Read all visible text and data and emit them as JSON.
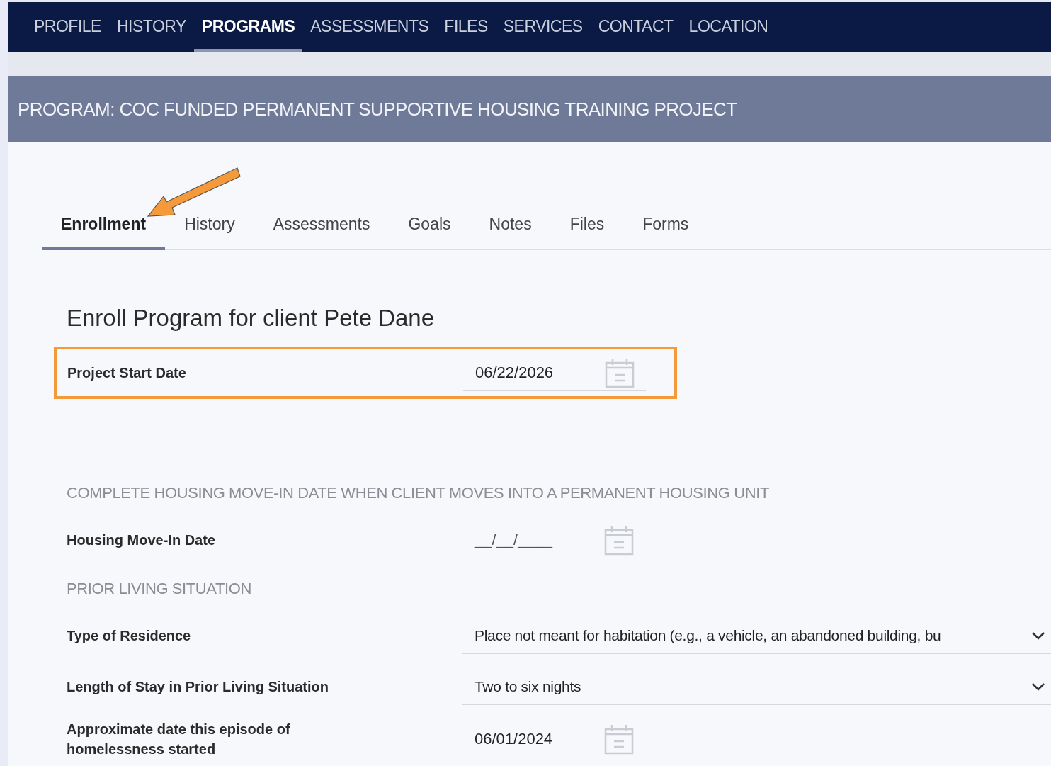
{
  "nav": [
    {
      "label": "PROFILE",
      "selected": false
    },
    {
      "label": "HISTORY",
      "selected": false
    },
    {
      "label": "PROGRAMS",
      "selected": true
    },
    {
      "label": "ASSESSMENTS",
      "selected": false
    },
    {
      "label": "FILES",
      "selected": false
    },
    {
      "label": "SERVICES",
      "selected": false
    },
    {
      "label": "CONTACT",
      "selected": false
    },
    {
      "label": "LOCATION",
      "selected": false
    }
  ],
  "program_title": "PROGRAM: COC FUNDED PERMANENT SUPPORTIVE HOUSING TRAINING PROJECT",
  "tabs": [
    {
      "label": "Enrollment",
      "selected": true
    },
    {
      "label": "History",
      "selected": false
    },
    {
      "label": "Assessments",
      "selected": false
    },
    {
      "label": "Goals",
      "selected": false
    },
    {
      "label": "Notes",
      "selected": false
    },
    {
      "label": "Files",
      "selected": false
    },
    {
      "label": "Forms",
      "selected": false
    }
  ],
  "form_title": "Enroll Program for client Pete Dane",
  "rows": [
    {
      "kind": "date",
      "label": "Project Start Date",
      "value": "06/22/2026",
      "highlighted": true
    },
    {
      "kind": "section",
      "label": "COMPLETE HOUSING MOVE-IN DATE WHEN CLIENT MOVES INTO A PERMANENT HOUSING UNIT"
    },
    {
      "kind": "date",
      "label": "Housing Move-In Date",
      "placeholder": "__/__/____",
      "highlighted": false
    },
    {
      "kind": "section",
      "label": "PRIOR LIVING SITUATION"
    },
    {
      "kind": "select",
      "label": "Type of Residence",
      "value": "Place not meant for habitation (e.g., a vehicle, an abandoned building, bu",
      "highlighted": false
    },
    {
      "kind": "select",
      "label": "Length of Stay in Prior Living Situation",
      "value": "Two to six nights",
      "highlighted": false
    },
    {
      "kind": "date",
      "label": "Approximate date this episode of homelessness started",
      "value": "06/01/2024",
      "highlighted": false
    }
  ]
}
